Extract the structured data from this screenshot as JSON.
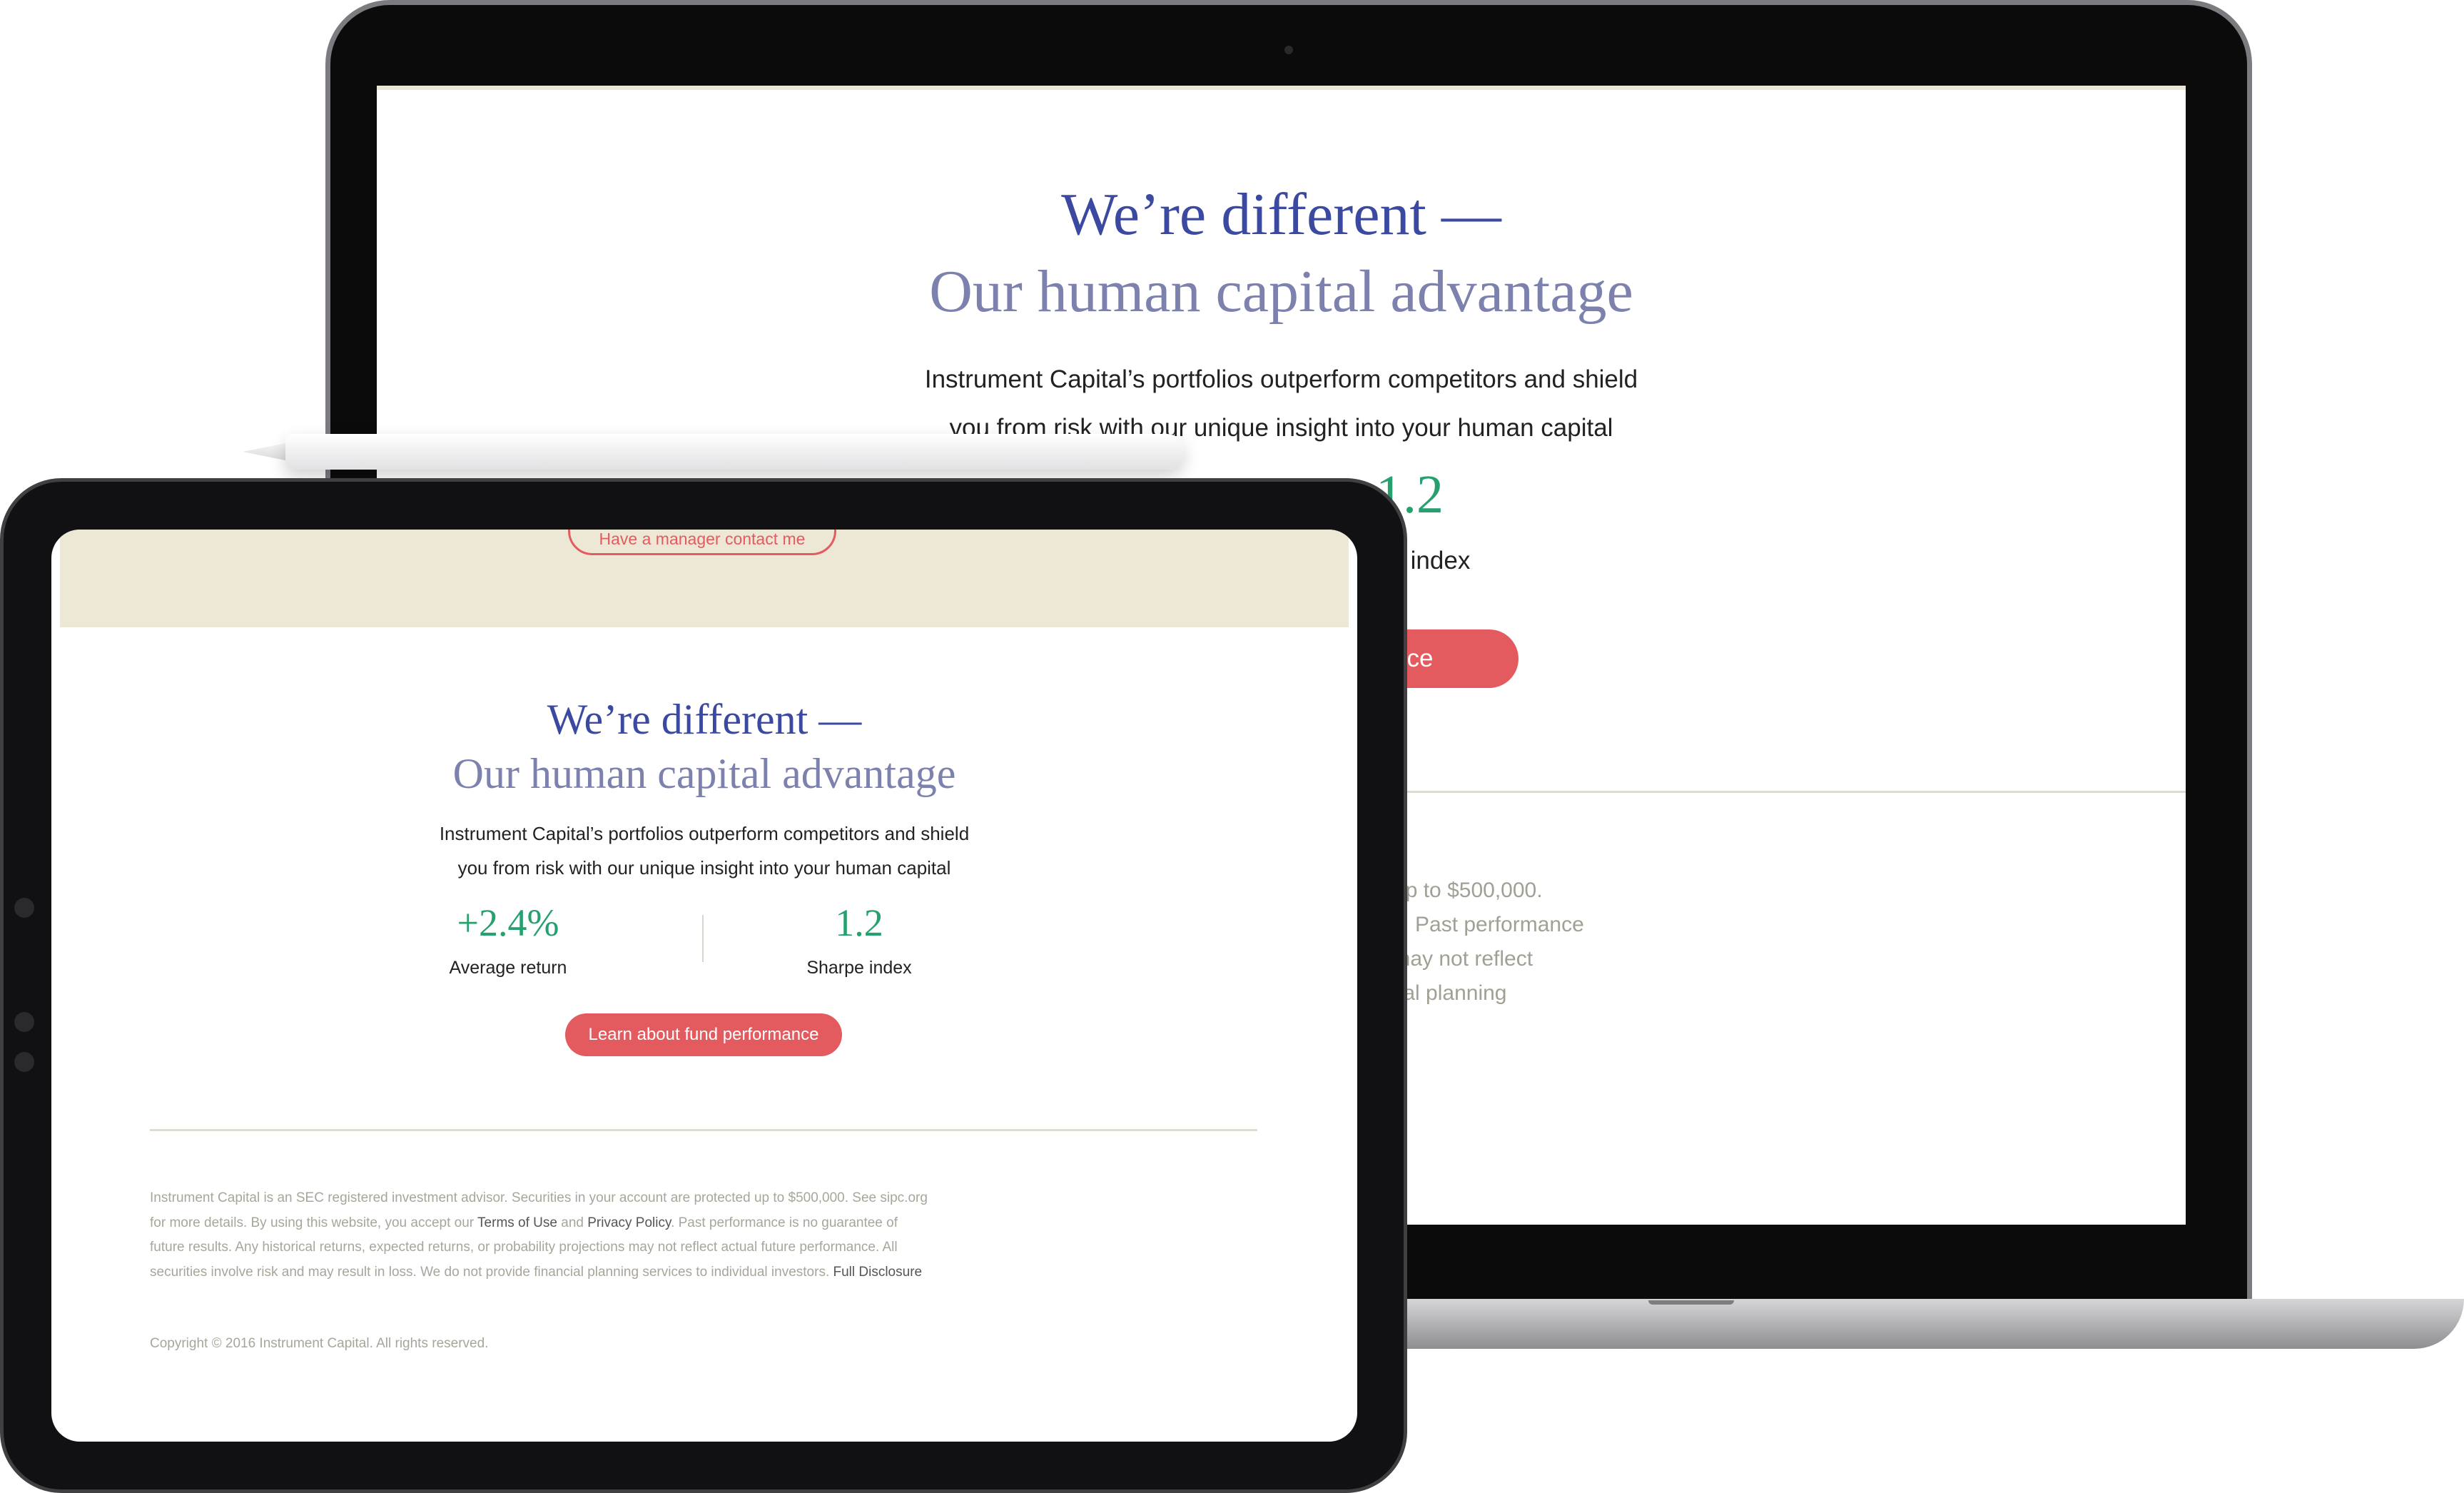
{
  "laptop": {
    "heading_line1": "We’re different —",
    "heading_line2": "Our human capital advantage",
    "intro_line1": "Instrument Capital’s portfolios outperform competitors and shield",
    "intro_line2": "you from risk with our unique insight into your human capital",
    "stat_value": "1.2",
    "stat_label": "pe index",
    "button_label": "nce",
    "disclosure_lines": [
      "d up to $500,000.",
      "Past performance",
      "s may not reflect",
      "ncial planning"
    ]
  },
  "tablet": {
    "contact_button_label": "Have a manager contact me",
    "heading_line1": "We’re different —",
    "heading_line2": "Our human capital advantage",
    "intro_line1": "Instrument Capital’s portfolios outperform competitors and shield",
    "intro_line2": "you from risk with our unique insight into your human capital",
    "stats": [
      {
        "value": "+2.4%",
        "label": "Average return"
      },
      {
        "value": "1.2",
        "label": "Sharpe index"
      }
    ],
    "fund_button_label": "Learn about fund performance",
    "disclosure": {
      "part1": "Instrument Capital is an SEC registered investment advisor. Securities in your account are protected up to $500,000. See sipc.org for more details. By using this website, you accept our",
      "terms_link": "Terms of Use",
      "and": "and",
      "privacy_link": "Privacy Policy",
      "part2": ". Past performance is no guarantee of future results. Any historical returns, expected returns, or probability projections may not reflect actual future performance. All securities involve risk and may result in loss. We do not provide financial planning services to individual investors.",
      "full_disclosure_link": "Full Disclosure"
    },
    "copyright": "Copyright © 2016 Instrument Capital. All rights reserved."
  },
  "colors": {
    "heading_blue": "#3b4aa0",
    "heading_lavender": "#7c81ad",
    "stat_green": "#26a06f",
    "accent_red": "#e35a5f",
    "beige_band": "#ede7d5"
  }
}
